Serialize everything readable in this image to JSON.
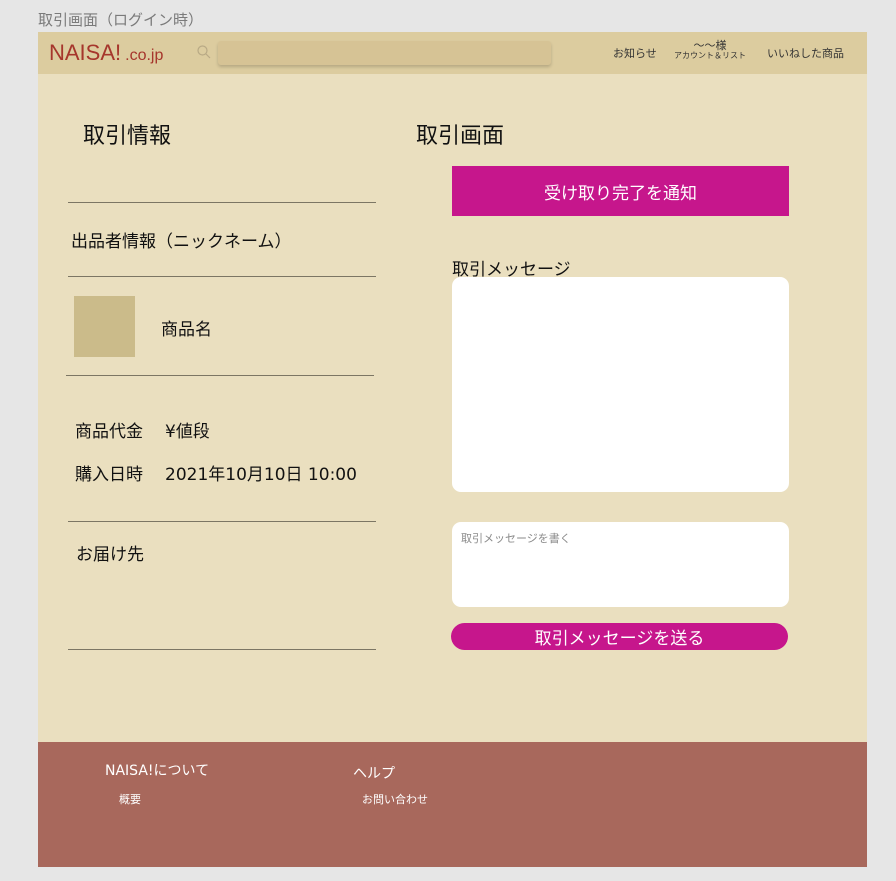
{
  "frame_label": "取引画面（ログイン時）",
  "header": {
    "logo_main": "NAISA!",
    "logo_sub": ".co.jp",
    "search_placeholder": "",
    "nav": {
      "notice": "お知らせ",
      "account_name": "〜〜様",
      "account_sub": "アカウント＆リスト",
      "likes": "いいねした商品"
    }
  },
  "left": {
    "title": "取引情報",
    "seller": "出品者情報（ニックネーム）",
    "product_name": "商品名",
    "price_label": "商品代金",
    "price_value": "¥値段",
    "date_label": "購入日時",
    "date_value": "2021年10月10日 10:00",
    "shipping_label": "お届け先"
  },
  "right": {
    "title": "取引画面",
    "complete_button": "受け取り完了を通知",
    "message_label": "取引メッセージ",
    "message_placeholder": "取引メッセージを書く",
    "send_button": "取引メッセージを送る"
  },
  "footer": {
    "col1_heading": "NAISA!について",
    "col1_link": "概要",
    "col2_heading": "ヘルプ",
    "col2_link": "お問い合わせ"
  },
  "colors": {
    "accent": "#c6168c",
    "page_bg": "#eadfbf",
    "header_bg": "#dccc9f",
    "footer_bg": "#a8685c",
    "logo": "#a6362c"
  }
}
